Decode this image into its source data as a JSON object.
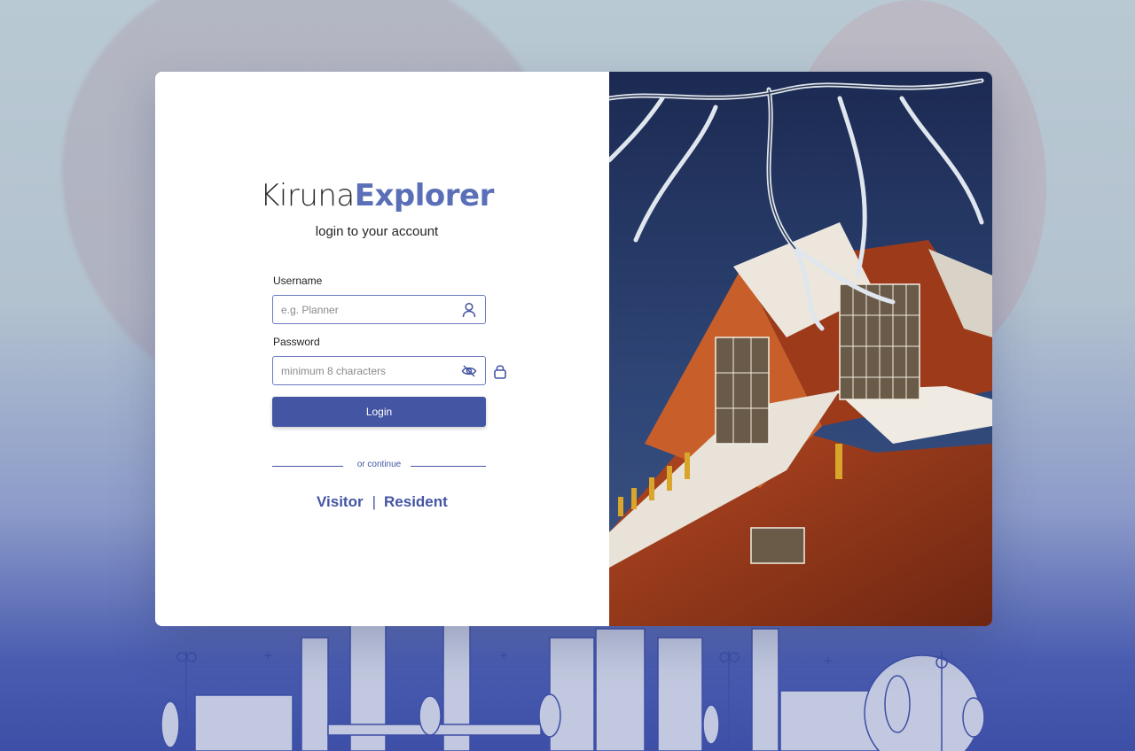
{
  "brand": {
    "part1": "Kiruna",
    "part2": "Explorer"
  },
  "subtitle": "login to your account",
  "form": {
    "username_label": "Username",
    "username_placeholder": "e.g. Planner",
    "password_label": "Password",
    "password_placeholder": "minimum 8 characters",
    "login_label": "Login"
  },
  "divider_text": "or continue",
  "alt_links": {
    "visitor": "Visitor",
    "separator": "|",
    "resident": "Resident"
  },
  "icons": {
    "username": "user-icon",
    "password_toggle": "eye-off-icon",
    "lock": "lock-icon"
  },
  "colors": {
    "accent": "#4455a3",
    "brand_accent": "#5b6fb8",
    "field_border": "#6a7bbf"
  }
}
